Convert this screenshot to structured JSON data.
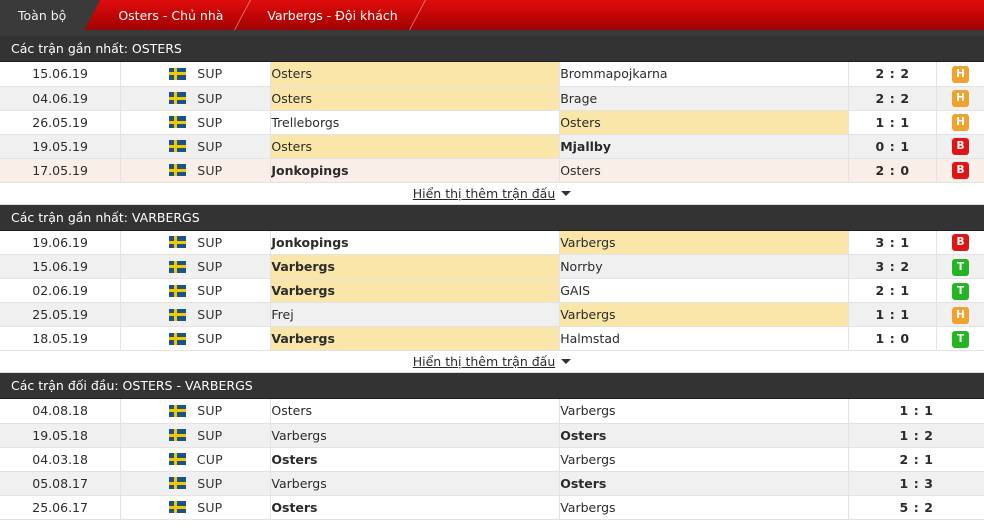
{
  "tabs": [
    {
      "label": "Toàn bộ",
      "active": true
    },
    {
      "label": "Osters - Chủ nhà",
      "active": false
    },
    {
      "label": "Varbergs - Đội khách",
      "active": false
    }
  ],
  "show_more_label": "Hiển thị thêm trận đấu",
  "colors": {
    "tab_red": "#c00505",
    "tab_active": "#3a3a3a",
    "section_header": "#333333",
    "highlight_yellow": "#fae6a8",
    "row_alt": "#f0f0f0",
    "row_pink": "#faeee8",
    "badge_home_win": "#f0a12e",
    "badge_loss": "#e01616",
    "badge_win": "#24b424"
  },
  "sections": [
    {
      "title": "Các trận gần nhất: OSTERS",
      "has_badges": true,
      "has_show_more": true,
      "rows": [
        {
          "date": "15.06.19",
          "flag": "sweden-flag",
          "league": "SUP",
          "home": "Osters",
          "away": "Brommapojkarna",
          "home_bold": false,
          "away_bold": false,
          "home_hi": true,
          "away_hi": false,
          "score": "2 : 2",
          "badge": "H",
          "row_style": "white"
        },
        {
          "date": "04.06.19",
          "flag": "sweden-flag",
          "league": "SUP",
          "home": "Osters",
          "away": "Brage",
          "home_bold": false,
          "away_bold": false,
          "home_hi": true,
          "away_hi": false,
          "score": "2 : 2",
          "badge": "H",
          "row_style": "alt"
        },
        {
          "date": "26.05.19",
          "flag": "sweden-flag",
          "league": "SUP",
          "home": "Trelleborgs",
          "away": "Osters",
          "home_bold": false,
          "away_bold": false,
          "home_hi": false,
          "away_hi": true,
          "score": "1 : 1",
          "badge": "H",
          "row_style": "white"
        },
        {
          "date": "19.05.19",
          "flag": "sweden-flag",
          "league": "SUP",
          "home": "Osters",
          "away": "Mjallby",
          "home_bold": false,
          "away_bold": true,
          "home_hi": true,
          "away_hi": false,
          "score": "0 : 1",
          "badge": "B",
          "row_style": "alt"
        },
        {
          "date": "17.05.19",
          "flag": "sweden-flag",
          "league": "SUP",
          "home": "Jonkopings",
          "away": "Osters",
          "home_bold": true,
          "away_bold": false,
          "home_hi": false,
          "away_hi": false,
          "score": "2 : 0",
          "badge": "B",
          "row_style": "pink"
        }
      ]
    },
    {
      "title": "Các trận gần nhất: VARBERGS",
      "has_badges": true,
      "has_show_more": true,
      "rows": [
        {
          "date": "19.06.19",
          "flag": "sweden-flag",
          "league": "SUP",
          "home": "Jonkopings",
          "away": "Varbergs",
          "home_bold": true,
          "away_bold": false,
          "home_hi": false,
          "away_hi": true,
          "score": "3 : 1",
          "badge": "B",
          "row_style": "white"
        },
        {
          "date": "15.06.19",
          "flag": "sweden-flag",
          "league": "SUP",
          "home": "Varbergs",
          "away": "Norrby",
          "home_bold": true,
          "away_bold": false,
          "home_hi": true,
          "away_hi": false,
          "score": "3 : 2",
          "badge": "T",
          "row_style": "alt"
        },
        {
          "date": "02.06.19",
          "flag": "sweden-flag",
          "league": "SUP",
          "home": "Varbergs",
          "away": "GAIS",
          "home_bold": true,
          "away_bold": false,
          "home_hi": true,
          "away_hi": false,
          "score": "2 : 1",
          "badge": "T",
          "row_style": "white"
        },
        {
          "date": "25.05.19",
          "flag": "sweden-flag",
          "league": "SUP",
          "home": "Frej",
          "away": "Varbergs",
          "home_bold": false,
          "away_bold": false,
          "home_hi": false,
          "away_hi": true,
          "score": "1 : 1",
          "badge": "H",
          "row_style": "alt"
        },
        {
          "date": "18.05.19",
          "flag": "sweden-flag",
          "league": "SUP",
          "home": "Varbergs",
          "away": "Halmstad",
          "home_bold": true,
          "away_bold": false,
          "home_hi": true,
          "away_hi": false,
          "score": "1 : 0",
          "badge": "T",
          "row_style": "white"
        }
      ]
    },
    {
      "title": "Các trận đối đầu: OSTERS - VARBERGS",
      "has_badges": false,
      "has_show_more": false,
      "rows": [
        {
          "date": "04.08.18",
          "flag": "sweden-flag",
          "league": "SUP",
          "home": "Osters",
          "away": "Varbergs",
          "home_bold": false,
          "away_bold": false,
          "home_hi": false,
          "away_hi": false,
          "score": "1 : 1",
          "badge": "",
          "row_style": "white"
        },
        {
          "date": "19.05.18",
          "flag": "sweden-flag",
          "league": "SUP",
          "home": "Varbergs",
          "away": "Osters",
          "home_bold": false,
          "away_bold": true,
          "home_hi": false,
          "away_hi": false,
          "score": "1 : 2",
          "badge": "",
          "row_style": "alt"
        },
        {
          "date": "04.03.18",
          "flag": "sweden-flag",
          "league": "CUP",
          "home": "Osters",
          "away": "Varbergs",
          "home_bold": true,
          "away_bold": false,
          "home_hi": false,
          "away_hi": false,
          "score": "2 : 1",
          "badge": "",
          "row_style": "white"
        },
        {
          "date": "05.08.17",
          "flag": "sweden-flag",
          "league": "SUP",
          "home": "Varbergs",
          "away": "Osters",
          "home_bold": false,
          "away_bold": true,
          "home_hi": false,
          "away_hi": false,
          "score": "1 : 3",
          "badge": "",
          "row_style": "alt"
        },
        {
          "date": "25.06.17",
          "flag": "sweden-flag",
          "league": "SUP",
          "home": "Osters",
          "away": "Varbergs",
          "home_bold": true,
          "away_bold": false,
          "home_hi": false,
          "away_hi": false,
          "score": "5 : 2",
          "badge": "",
          "row_style": "white"
        }
      ]
    }
  ]
}
